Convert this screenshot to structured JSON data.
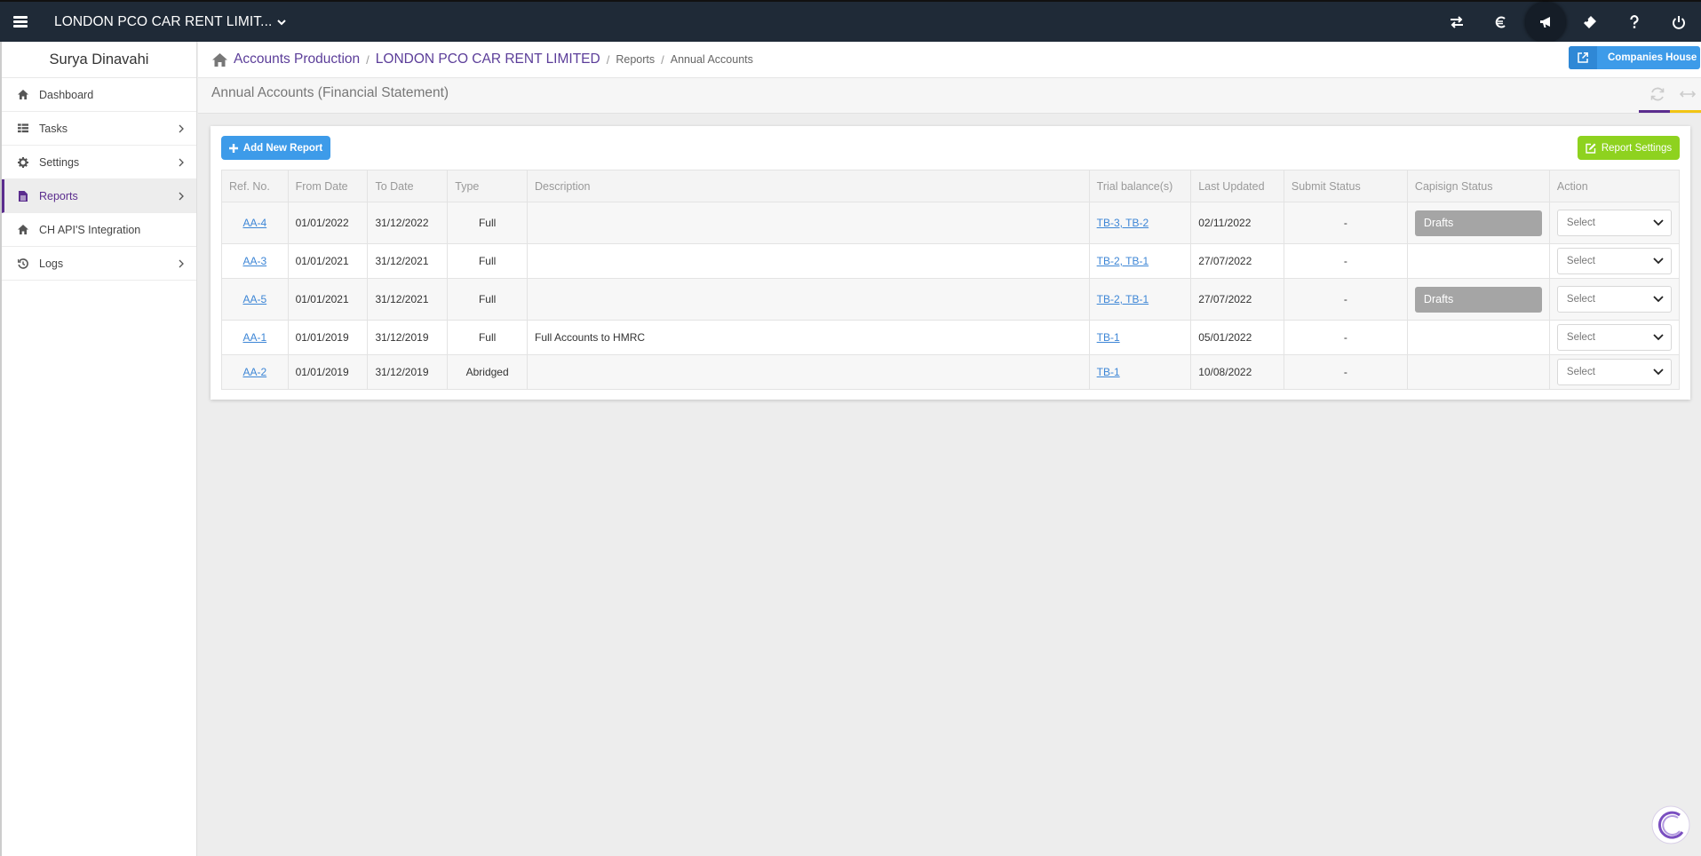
{
  "topbar": {
    "company": "LONDON PCO CAR RENT LIMIT...",
    "icons": [
      "hamburger-icon",
      "transfer-icon",
      "currency-icon",
      "megaphone-icon",
      "ticket-icon",
      "help-icon",
      "power-icon"
    ]
  },
  "sidebar": {
    "user": "Surya Dinavahi",
    "items": [
      {
        "label": "Dashboard",
        "icon": "home-icon"
      },
      {
        "label": "Tasks",
        "icon": "tasks-icon"
      },
      {
        "label": "Settings",
        "icon": "gear-icon"
      },
      {
        "label": "Reports",
        "icon": "document-icon"
      },
      {
        "label": "CH API'S Integration",
        "icon": "home-icon"
      },
      {
        "label": "Logs",
        "icon": "history-icon"
      }
    ]
  },
  "breadcrumb": {
    "items": [
      "Accounts Production",
      "LONDON PCO CAR RENT LIMITED",
      "Reports",
      "Annual Accounts"
    ]
  },
  "companies_house_label": "Companies House",
  "page_title": "Annual Accounts (Financial Statement)",
  "buttons": {
    "add": "Add New Report",
    "settings": "Report Settings"
  },
  "table": {
    "headers": [
      "Ref. No.",
      "From Date",
      "To Date",
      "Type",
      "Description",
      "Trial balance(s)",
      "Last Updated",
      "Submit Status",
      "Capisign Status",
      "Action"
    ],
    "rows": [
      {
        "ref": "AA-4",
        "from": "01/01/2022",
        "to": "31/12/2022",
        "type": "Full",
        "description": "",
        "tb": "TB-3, TB-2",
        "updated": "02/11/2022",
        "submit": "-",
        "capisign": "Drafts",
        "action": "Select"
      },
      {
        "ref": "AA-3",
        "from": "01/01/2021",
        "to": "31/12/2021",
        "type": "Full",
        "description": "",
        "tb": "TB-2, TB-1",
        "updated": "27/07/2022",
        "submit": "-",
        "capisign": "",
        "action": "Select"
      },
      {
        "ref": "AA-5",
        "from": "01/01/2021",
        "to": "31/12/2021",
        "type": "Full",
        "description": "",
        "tb": "TB-2, TB-1",
        "updated": "27/07/2022",
        "submit": "-",
        "capisign": "Drafts",
        "action": "Select"
      },
      {
        "ref": "AA-1",
        "from": "01/01/2019",
        "to": "31/12/2019",
        "type": "Full",
        "description": "Full Accounts to HMRC",
        "tb": "TB-1",
        "updated": "05/01/2022",
        "submit": "-",
        "capisign": "",
        "action": "Select"
      },
      {
        "ref": "AA-2",
        "from": "01/01/2019",
        "to": "31/12/2019",
        "type": "Abridged",
        "description": "",
        "tb": "TB-1",
        "updated": "10/08/2022",
        "submit": "-",
        "capisign": "",
        "action": "Select"
      }
    ]
  },
  "colors": {
    "topbar": "#1f2a37",
    "accent_purple": "#5b2d8e",
    "primary_blue": "#3d9be9",
    "success_green": "#8ed21f",
    "drafts_gray": "#a5a5a5"
  }
}
